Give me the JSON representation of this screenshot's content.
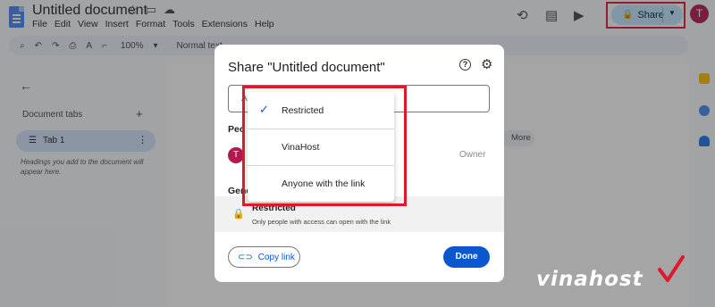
{
  "app": {
    "doc_title": "Untitled document",
    "menus": [
      "File",
      "Edit",
      "View",
      "Insert",
      "Format",
      "Tools",
      "Extensions",
      "Help"
    ]
  },
  "header": {
    "share_label": "Share",
    "avatar_letter": "T"
  },
  "toolbar": {
    "zoom": "100%",
    "style": "Normal text"
  },
  "sidebar": {
    "title": "Document tabs",
    "tab_label": "Tab 1",
    "hint": "Headings you add to the document will appear here."
  },
  "background": {
    "more_chip": "More"
  },
  "dialog": {
    "title": "Share \"Untitled document\"",
    "add_placeholder": "Ad",
    "people_label": "Peo",
    "person_avatar": "T",
    "owner_label": "Owner",
    "general_label": "Gene",
    "access_mode": "Restricted",
    "access_desc": "Only people with access can open with the link",
    "copy_link": "Copy link",
    "done": "Done"
  },
  "menu": {
    "items": [
      {
        "label": "Restricted",
        "selected": true
      },
      {
        "label": "VinaHost",
        "selected": false
      },
      {
        "label": "Anyone with the link",
        "selected": false
      }
    ]
  },
  "watermark": {
    "logo_text": "vinahost"
  },
  "colors": {
    "accent": "#0b57d0",
    "share_bg": "#c2e7ff",
    "highlight": "#e0182d",
    "avatar": "#b5184f"
  }
}
